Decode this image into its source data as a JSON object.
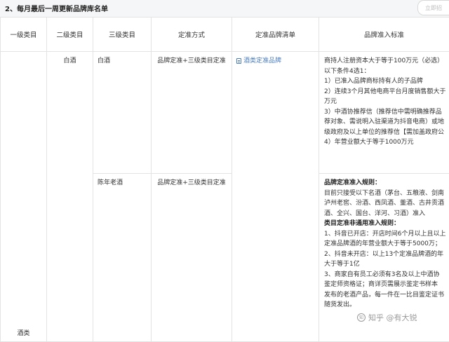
{
  "section_title": "2、每月最后一周更新品牌库名单",
  "top_right_pill": "立即招",
  "table": {
    "headers": [
      "一级类目",
      "二级类目",
      "三级类目",
      "定准方式",
      "定准品牌清单",
      "品牌准入标准"
    ],
    "cat1": "酒类",
    "cat2": "白酒",
    "rows": [
      {
        "cat3": "白酒",
        "method": "品牌定准+三级类目定准",
        "brand_list": "酒类定准品牌",
        "standard": [
          {
            "text": "商持人注册资本大于等于100万元（必选）",
            "bold": false
          },
          {
            "text": "以下条件4选1：",
            "bold": false
          },
          {
            "text": "1）已准入品牌商标持有人的子品牌",
            "bold": false
          },
          {
            "text": "2）连续3个月其他电商平台月度销售额大于",
            "bold": false
          },
          {
            "text": "万元",
            "bold": false
          },
          {
            "text": "3）中酒协推荐信（推荐信中需明确推荐品",
            "bold": false
          },
          {
            "text": "荐对象、需说明入驻渠道为抖音电商）或地",
            "bold": false
          },
          {
            "text": "级政府及以上单位的推荐信【需加盖政府公",
            "bold": false
          },
          {
            "text": "4）年营业额大于等于1000万元",
            "bold": false
          }
        ]
      },
      {
        "cat3": "陈年老酒",
        "method": "品牌定准+三级类目定准",
        "brand_list": "",
        "standard": [
          {
            "text": "品牌定准准入规则：",
            "bold": true
          },
          {
            "text": "目前只接受以下名酒（茅台、五粮液、剑南",
            "bold": false
          },
          {
            "text": "泸州老窖、汾酒、西凤酒、董酒、古井贡酒",
            "bold": false
          },
          {
            "text": "酒、全兴、国台、洋河、习酒）准入",
            "bold": false
          },
          {
            "text": "类目定准非通用准入规则：",
            "bold": true
          },
          {
            "text": "1、抖音已开店：开店时间6个月以上且以上",
            "bold": false
          },
          {
            "text": "定准品牌酒的年营业额大于等于5000万；",
            "bold": false
          },
          {
            "text": "2、抖音未开店：以上13个定准品牌酒的年",
            "bold": false
          },
          {
            "text": "大于等于1亿",
            "bold": false
          },
          {
            "text": "3、商家自有员工必须有3名及以上中酒协",
            "bold": false
          },
          {
            "text": "鉴定师资格证；商详页需展示鉴定书样本",
            "bold": false
          },
          {
            "text": "发布的老酒产品，每一件在一比目鉴定证书",
            "bold": false
          },
          {
            "text": "随货发出。",
            "bold": false
          }
        ]
      }
    ]
  },
  "watermark": "知乎 @有大锐"
}
